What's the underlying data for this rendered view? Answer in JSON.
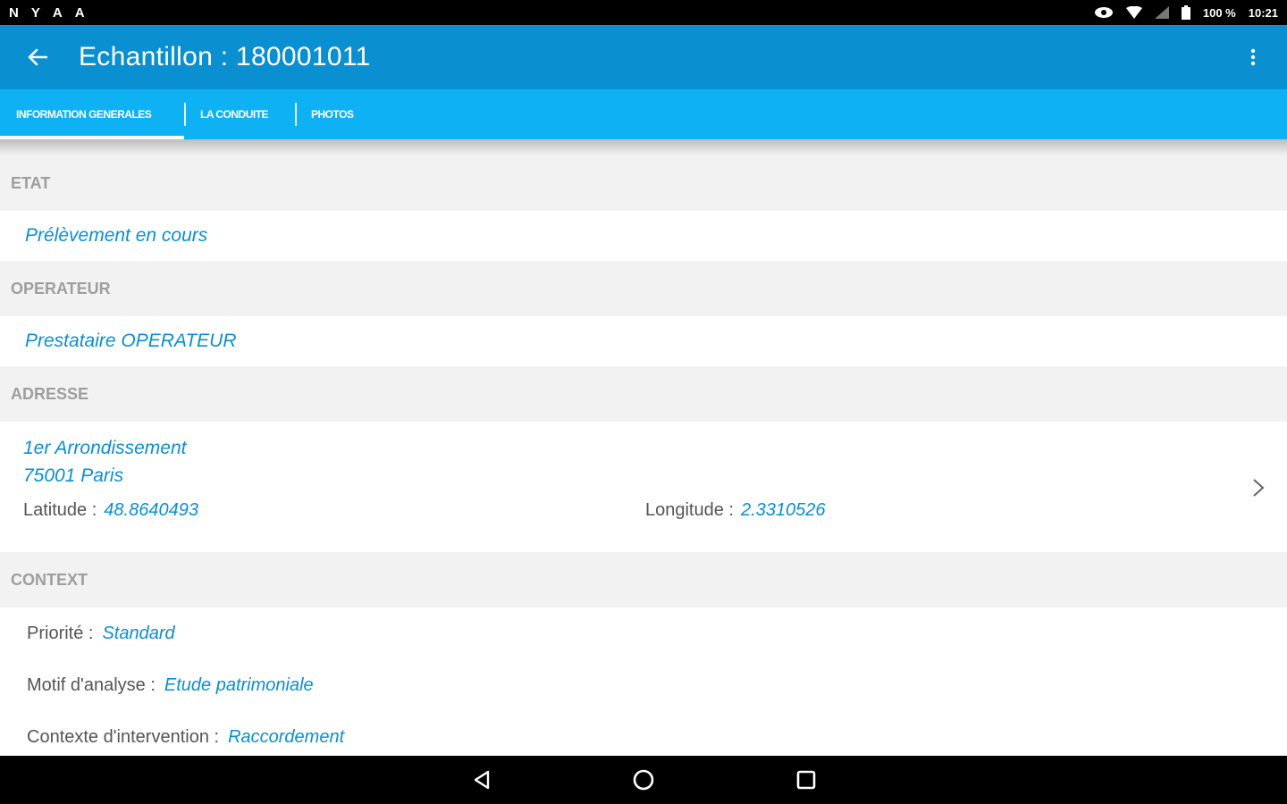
{
  "status_bar": {
    "left_icons": [
      "N",
      "Y",
      "A",
      "A"
    ],
    "battery": "100 %",
    "time": "10:21"
  },
  "app_bar": {
    "title": "Echantillon : 180001011"
  },
  "tabs": [
    {
      "label": "Information generales",
      "active": true
    },
    {
      "label": "La conduite",
      "active": false
    },
    {
      "label": "Photos",
      "active": false
    }
  ],
  "sections": {
    "etat": {
      "header": "ETAT",
      "value": "Prélèvement en cours"
    },
    "operateur": {
      "header": "OPERATEUR",
      "value": "Prestataire OPERATEUR"
    },
    "adresse": {
      "header": "ADRESSE",
      "line1": "1er Arrondissement",
      "line2": "75001 Paris",
      "latitude_label": "Latitude :",
      "latitude_value": "48.8640493",
      "longitude_label": "Longitude :",
      "longitude_value": "2.3310526"
    },
    "context": {
      "header": "CONTEXT",
      "rows": [
        {
          "label": "Priorité :",
          "value": "Standard"
        },
        {
          "label": "Motif d'analyse :",
          "value": "Etude patrimoniale"
        },
        {
          "label": "Contexte d'intervention :",
          "value": "Raccordement"
        }
      ]
    }
  },
  "colors": {
    "app_bar": "#0a8fd1",
    "tab_bar": "#0fb1f5",
    "value_text": "#0a8fd1",
    "header_text": "#9e9e9e"
  }
}
